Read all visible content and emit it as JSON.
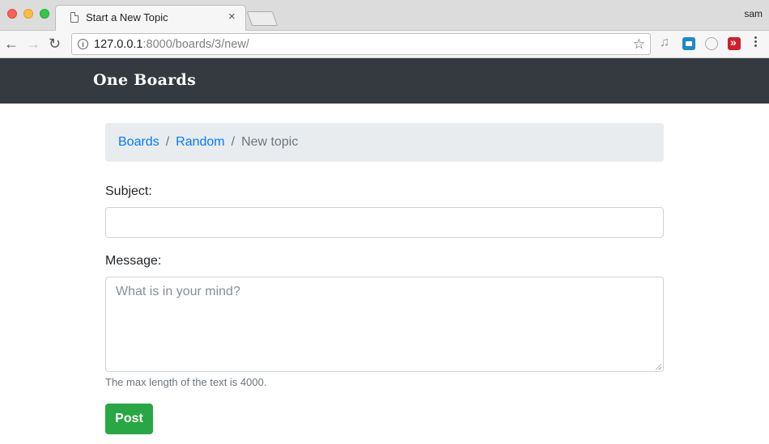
{
  "browser": {
    "tab_title": "Start a New Topic",
    "tab_close": "×",
    "user": "sam",
    "url_host": "127.0.0.1",
    "url_rest": ":8000/boards/3/new/",
    "back_glyph": "←",
    "forward_glyph": "→",
    "reload_glyph": "↻",
    "star_glyph": "☆",
    "info_glyph": "i",
    "music_glyph": "♫",
    "icons": [
      "document-icon",
      "back-icon",
      "forward-icon",
      "reload-icon",
      "info-icon",
      "star-icon",
      "music-extension-icon",
      "camera-extension-icon",
      "circle-extension-icon",
      "fast-forward-extension-icon",
      "menu-dots-icon"
    ]
  },
  "navbar": {
    "brand": "One Boards"
  },
  "breadcrumb": {
    "items": [
      "Boards",
      "Random"
    ],
    "separator": "/",
    "active": "New topic"
  },
  "form": {
    "subject_label": "Subject:",
    "subject_value": "",
    "message_label": "Message:",
    "message_placeholder": "What is in your mind?",
    "help_text": "The max length of the text is 4000.",
    "submit_label": "Post"
  },
  "colors": {
    "navbar": "#343a40",
    "link": "#007bff",
    "breadcrumb_bg": "#e9ecef",
    "button": "#28a745",
    "muted": "#6c757d"
  }
}
